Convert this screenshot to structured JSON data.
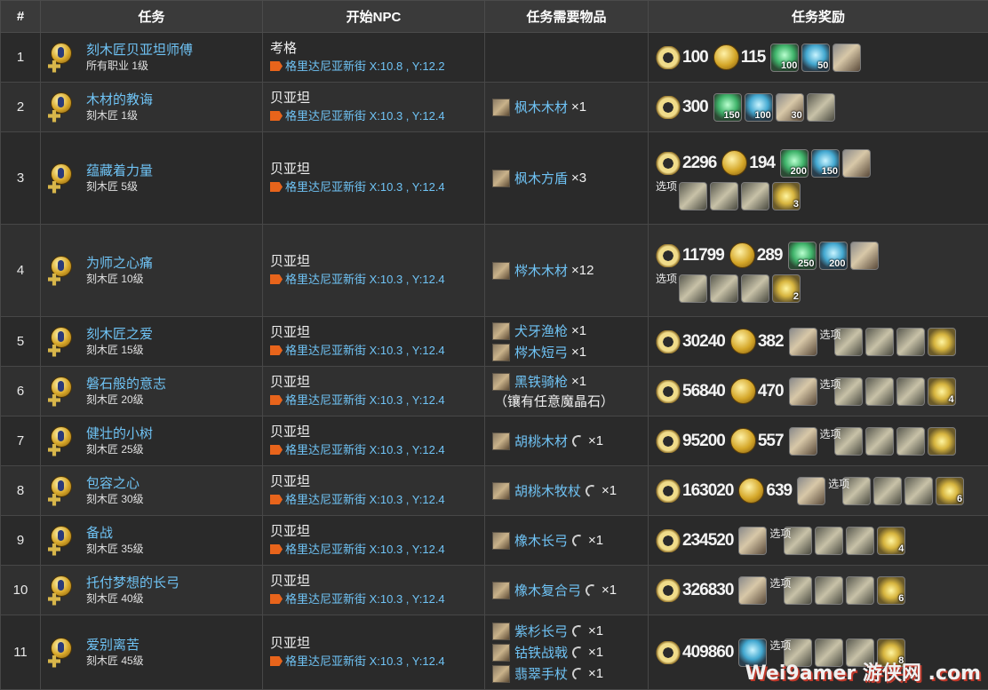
{
  "headers": {
    "num": "#",
    "quest": "任务",
    "npc": "开始NPC",
    "items": "任务需要物品",
    "rewards": "任务奖励"
  },
  "option_label": "选项",
  "rows": [
    {
      "num": "1",
      "name": "刻木匠贝亚坦师傅",
      "sub": "所有职业 1级",
      "npc": "考格",
      "loc": "格里达尼亚新街 X:10.8 , Y:12.2",
      "items": [],
      "exp": "100",
      "gil": "115",
      "icons": [
        {
          "type": "green",
          "count": "100",
          "name": "wind-crystal-icon"
        },
        {
          "type": "blue",
          "count": "50",
          "name": "ice-crystal-icon"
        },
        {
          "type": "tool",
          "count": "",
          "name": "saw-icon"
        }
      ],
      "opt_icons": []
    },
    {
      "num": "2",
      "name": "木材的教诲",
      "sub": "刻木匠 1级",
      "npc": "贝亚坦",
      "loc": "格里达尼亚新街 X:10.3 , Y:12.4",
      "items": [
        {
          "name": "枫木木材",
          "qty": "×1",
          "hq": false
        }
      ],
      "exp": "300",
      "gil": "",
      "icons": [
        {
          "type": "green",
          "count": "150",
          "name": "wind-crystal-icon"
        },
        {
          "type": "blue",
          "count": "100",
          "name": "ice-crystal-icon"
        },
        {
          "type": "tool",
          "count": "30",
          "name": "mallet-icon"
        },
        {
          "type": "gear",
          "count": "",
          "name": "robe-icon"
        }
      ],
      "opt_icons": []
    },
    {
      "num": "3",
      "name": "蕴藏着力量",
      "sub": "刻木匠 5级",
      "npc": "贝亚坦",
      "loc": "格里达尼亚新街 X:10.3 , Y:12.4",
      "items": [
        {
          "name": "枫木方盾",
          "qty": "×3",
          "hq": false
        }
      ],
      "exp": "2296",
      "gil": "194",
      "icons": [
        {
          "type": "green",
          "count": "200",
          "name": "wind-crystal-icon"
        },
        {
          "type": "blue",
          "count": "150",
          "name": "ice-crystal-icon"
        },
        {
          "type": "tool",
          "count": "",
          "name": "hammer-icon"
        }
      ],
      "opt_icons": [
        {
          "type": "gear",
          "count": "",
          "name": "hat-icon"
        },
        {
          "type": "gear",
          "count": "",
          "name": "trousers-icon"
        },
        {
          "type": "gear",
          "count": "",
          "name": "boots-icon"
        },
        {
          "type": "bag",
          "count": "3",
          "name": "materia-bag-icon"
        }
      ]
    },
    {
      "num": "4",
      "name": "为师之心痛",
      "sub": "刻木匠 10级",
      "npc": "贝亚坦",
      "loc": "格里达尼亚新街 X:10.3 , Y:12.4",
      "items": [
        {
          "name": "梣木木材",
          "qty": "×12",
          "hq": false
        }
      ],
      "exp": "11799",
      "gil": "289",
      "icons": [
        {
          "type": "green",
          "count": "250",
          "name": "wind-crystal-icon"
        },
        {
          "type": "blue",
          "count": "200",
          "name": "ice-crystal-icon"
        },
        {
          "type": "tool",
          "count": "",
          "name": "saw-icon"
        }
      ],
      "opt_icons": [
        {
          "type": "gear",
          "count": "",
          "name": "table-icon"
        },
        {
          "type": "gear",
          "count": "",
          "name": "robe-icon"
        },
        {
          "type": "gear",
          "count": "",
          "name": "gloves-icon"
        },
        {
          "type": "bag",
          "count": "2",
          "name": "materia-bag-icon"
        }
      ]
    },
    {
      "num": "5",
      "name": "刻木匠之爱",
      "sub": "刻木匠 15级",
      "npc": "贝亚坦",
      "loc": "格里达尼亚新街 X:10.3 , Y:12.4",
      "items": [
        {
          "name": "犬牙渔枪",
          "qty": "×1",
          "hq": false
        },
        {
          "name": "梣木短弓",
          "qty": "×1",
          "hq": false
        }
      ],
      "exp": "30240",
      "gil": "382",
      "icons": [
        {
          "type": "tool",
          "count": "",
          "name": "hammer-icon"
        }
      ],
      "opt_icons": [
        {
          "type": "gear",
          "count": "",
          "name": "vest-icon"
        },
        {
          "type": "gear",
          "count": "",
          "name": "belt-icon"
        },
        {
          "type": "gear",
          "count": "",
          "name": "boots-icon"
        },
        {
          "type": "bag",
          "count": "",
          "name": "materia-bag-icon"
        }
      ]
    },
    {
      "num": "6",
      "name": "磐石般的意志",
      "sub": "刻木匠 20级",
      "npc": "贝亚坦",
      "loc": "格里达尼亚新街 X:10.3 , Y:12.4",
      "items": [
        {
          "name": "黑铁骑枪",
          "qty": "×1",
          "hq": false
        }
      ],
      "item_note": "（镶有任意魔晶石）",
      "exp": "56840",
      "gil": "470",
      "icons": [
        {
          "type": "tool",
          "count": "",
          "name": "chisel-icon"
        }
      ],
      "opt_icons": [
        {
          "type": "gear",
          "count": "",
          "name": "helmet-icon"
        },
        {
          "type": "gear",
          "count": "",
          "name": "gauntlets-icon"
        },
        {
          "type": "gear",
          "count": "",
          "name": "trousers-icon"
        },
        {
          "type": "bag",
          "count": "4",
          "name": "materia-bag-icon"
        }
      ]
    },
    {
      "num": "7",
      "name": "健壮的小树",
      "sub": "刻木匠 25级",
      "npc": "贝亚坦",
      "loc": "格里达尼亚新街 X:10.3 , Y:12.4",
      "items": [
        {
          "name": "胡桃木材",
          "qty": "×1",
          "hq": true
        }
      ],
      "exp": "95200",
      "gil": "557",
      "icons": [
        {
          "type": "tool",
          "count": "",
          "name": "hammer-icon"
        }
      ],
      "opt_icons": [
        {
          "type": "gear",
          "count": "",
          "name": "goggles-icon"
        },
        {
          "type": "gear",
          "count": "",
          "name": "gauntlets-icon"
        },
        {
          "type": "gear",
          "count": "",
          "name": "gloves-icon"
        },
        {
          "type": "bag",
          "count": "",
          "name": "materia-bag-icon"
        }
      ]
    },
    {
      "num": "8",
      "name": "包容之心",
      "sub": "刻木匠 30级",
      "npc": "贝亚坦",
      "loc": "格里达尼亚新街 X:10.3 , Y:12.4",
      "items": [
        {
          "name": "胡桃木牧杖",
          "qty": "×1",
          "hq": true
        }
      ],
      "exp": "163020",
      "gil": "639",
      "icons": [
        {
          "type": "tool",
          "count": "",
          "name": "chisel-icon"
        }
      ],
      "opt_icons": [
        {
          "type": "gear",
          "count": "",
          "name": "hat-icon"
        },
        {
          "type": "gear",
          "count": "",
          "name": "gauntlets-icon"
        },
        {
          "type": "gear",
          "count": "",
          "name": "gloves-icon"
        },
        {
          "type": "bag",
          "count": "6",
          "name": "materia-bag-icon"
        }
      ]
    },
    {
      "num": "9",
      "name": "备战",
      "sub": "刻木匠 35级",
      "npc": "贝亚坦",
      "loc": "格里达尼亚新街 X:10.3 , Y:12.4",
      "items": [
        {
          "name": "橡木长弓",
          "qty": "×1",
          "hq": true
        }
      ],
      "exp": "234520",
      "gil": "",
      "icons": [
        {
          "type": "tool",
          "count": "",
          "name": "saw-icon"
        }
      ],
      "opt_icons": [
        {
          "type": "gear",
          "count": "",
          "name": "goggles-icon"
        },
        {
          "type": "gear",
          "count": "",
          "name": "shirt-icon"
        },
        {
          "type": "gear",
          "count": "",
          "name": "gloves-icon"
        },
        {
          "type": "bag",
          "count": "4",
          "name": "materia-bag-icon"
        }
      ]
    },
    {
      "num": "10",
      "name": "托付梦想的长弓",
      "sub": "刻木匠 40级",
      "npc": "贝亚坦",
      "loc": "格里达尼亚新街 X:10.3 , Y:12.4",
      "items": [
        {
          "name": "橡木复合弓",
          "qty": "×1",
          "hq": true
        }
      ],
      "exp": "326830",
      "gil": "",
      "icons": [
        {
          "type": "tool",
          "count": "",
          "name": "hammer-icon"
        }
      ],
      "opt_icons": [
        {
          "type": "gear",
          "count": "",
          "name": "hat-icon"
        },
        {
          "type": "gear",
          "count": "",
          "name": "shirt-icon"
        },
        {
          "type": "gear",
          "count": "",
          "name": "gloves-icon"
        },
        {
          "type": "bag",
          "count": "6",
          "name": "materia-bag-icon"
        }
      ]
    },
    {
      "num": "11",
      "name": "爱别离苦",
      "sub": "刻木匠 45级",
      "npc": "贝亚坦",
      "loc": "格里达尼亚新街 X:10.3 , Y:12.4",
      "items": [
        {
          "name": "紫杉长弓",
          "qty": "×1",
          "hq": true
        },
        {
          "name": "钴铁战戟",
          "qty": "×1",
          "hq": true
        },
        {
          "name": "翡翠手杖",
          "qty": "×1",
          "hq": true
        }
      ],
      "exp": "409860",
      "gil": "",
      "icons": [
        {
          "type": "blue",
          "count": "",
          "name": "saw-icon"
        }
      ],
      "opt_icons": [
        {
          "type": "gear",
          "count": "",
          "name": "hat-icon"
        },
        {
          "type": "gear",
          "count": "",
          "name": "shirt-icon"
        },
        {
          "type": "gear",
          "count": "",
          "name": "gloves-icon"
        },
        {
          "type": "bag",
          "count": "8",
          "name": "materia-bag-icon"
        }
      ]
    }
  ],
  "watermark": "Wei9amer 游侠网 .com"
}
